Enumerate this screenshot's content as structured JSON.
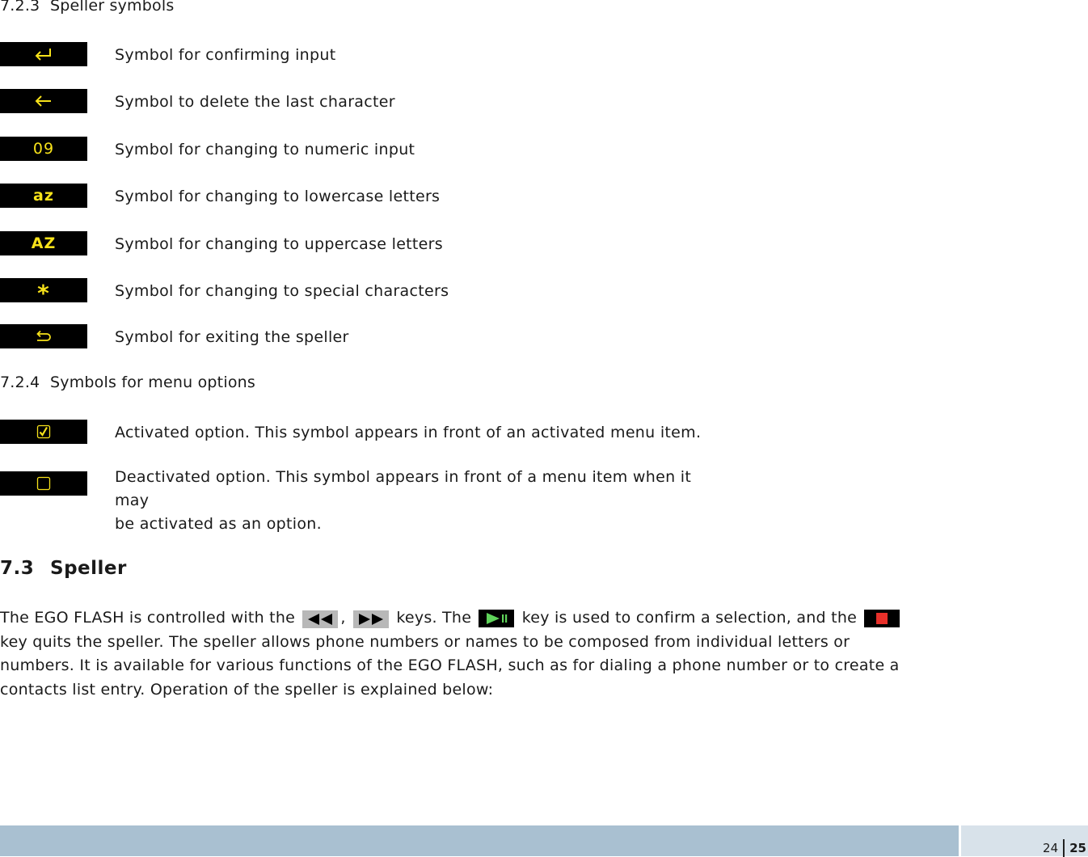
{
  "section_723": {
    "number": "7.2.3",
    "title": "Speller symbols"
  },
  "speller_symbols": [
    {
      "icon": "confirm-enter-arrow",
      "label": "",
      "description": "Symbol for confirming input"
    },
    {
      "icon": "left-arrow",
      "label": "",
      "description": "Symbol to delete the last character"
    },
    {
      "icon": "numeric-text",
      "label": "09",
      "description": "Symbol for changing to numeric input"
    },
    {
      "icon": "lowercase-text",
      "label": "az",
      "description": "Symbol for changing to lowercase letters"
    },
    {
      "icon": "uppercase-text",
      "label": "AZ",
      "description": "Symbol for changing to uppercase letters"
    },
    {
      "icon": "asterisk",
      "label": "*",
      "description": "Symbol for changing to special characters"
    },
    {
      "icon": "exit-return-arrow",
      "label": "",
      "description": "Symbol for exiting the speller"
    }
  ],
  "section_724": {
    "number": "7.2.4",
    "title": "Symbols for menu options"
  },
  "menu_symbols": [
    {
      "icon": "checked-checkbox",
      "description": "Activated option. This symbol appears in front of an activated menu item."
    },
    {
      "icon": "empty-checkbox",
      "description_line1": "Deactivated option. This symbol appears in front of a menu item when it may",
      "description_line2": "be activated as an option."
    }
  ],
  "section_73": {
    "number": "7.3",
    "title": "Speller"
  },
  "paragraph": {
    "part1": "The EGO FLASH is controlled with the",
    "part2": ",",
    "part3": "keys. The",
    "part4": "key is used to confirm a selection, and the",
    "part5": "key quits the speller. The speller allows phone numbers or names to be composed from individual letters or numbers. It is available for various functions of the EGO FLASH, such as for dialing a phone number or to create a contacts list entry. Operation of the speller is explained below:"
  },
  "keys": {
    "rewind": "rewind-key-icon",
    "forward": "fast-forward-key-icon",
    "play_pause": "play-pause-key-icon",
    "stop": "stop-key-icon"
  },
  "colors": {
    "symbol_yellow": "#f7e21a",
    "play_green": "#5fd35a",
    "stop_red": "#e8302a",
    "footer_blue": "#a9c0d1",
    "footer_light": "#d8e2ea"
  },
  "footer": {
    "left_page": "24",
    "right_page": "25"
  }
}
